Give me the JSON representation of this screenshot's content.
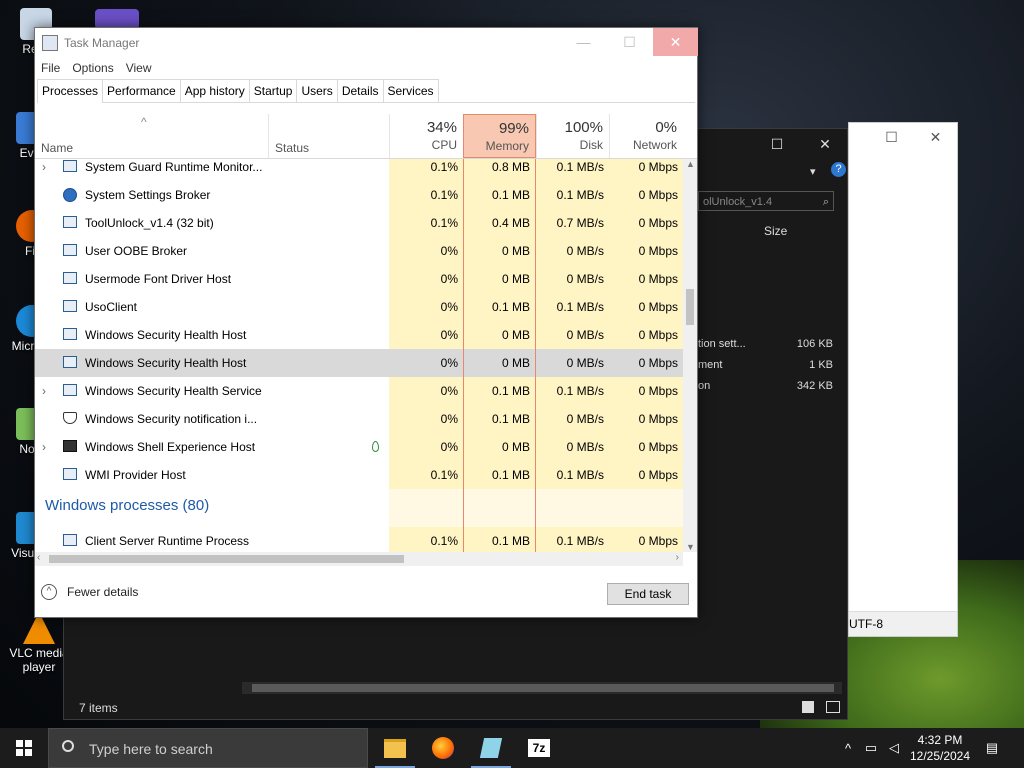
{
  "desktop": {
    "icons": [
      {
        "label": "Recy"
      },
      {
        "label": "Ever"
      },
      {
        "label": "Fir"
      },
      {
        "label": "Micr Ed"
      },
      {
        "label": "Note"
      },
      {
        "label": "Visua C"
      },
      {
        "label": "VLC media player"
      }
    ]
  },
  "explorer": {
    "search_text": "olUnlock_v1.4",
    "size_header": "Size",
    "rows": [
      {
        "name": "tion sett...",
        "size": "106 KB"
      },
      {
        "name": "ment",
        "size": "1 KB"
      },
      {
        "name": "on",
        "size": "342 KB"
      }
    ],
    "status": "7 items"
  },
  "notepad": {
    "encoding": "UTF-8"
  },
  "taskmanager": {
    "title": "Task Manager",
    "menu": [
      "File",
      "Options",
      "View"
    ],
    "tabs": [
      "Processes",
      "Performance",
      "App history",
      "Startup",
      "Users",
      "Details",
      "Services"
    ],
    "active_tab": "Processes",
    "columns": {
      "name": "Name",
      "status": "Status",
      "cpu": {
        "pct": "34%",
        "label": "CPU"
      },
      "memory": {
        "pct": "99%",
        "label": "Memory"
      },
      "disk": {
        "pct": "100%",
        "label": "Disk"
      },
      "network": {
        "pct": "0%",
        "label": "Network"
      }
    },
    "rows": [
      {
        "name": "System Guard Runtime Monitor...",
        "cpu": "0.1%",
        "mem": "0.8 MB",
        "disk": "0.1 MB/s",
        "net": "0 Mbps",
        "expandable": true,
        "icon": "window"
      },
      {
        "name": "System Settings Broker",
        "cpu": "0.1%",
        "mem": "0.1 MB",
        "disk": "0.1 MB/s",
        "net": "0 Mbps",
        "expandable": false,
        "icon": "gear"
      },
      {
        "name": "ToolUnlock_v1.4 (32 bit)",
        "cpu": "0.1%",
        "mem": "0.4 MB",
        "disk": "0.7 MB/s",
        "net": "0 Mbps",
        "expandable": false,
        "icon": "window"
      },
      {
        "name": "User OOBE Broker",
        "cpu": "0%",
        "mem": "0 MB",
        "disk": "0 MB/s",
        "net": "0 Mbps",
        "expandable": false,
        "icon": "window"
      },
      {
        "name": "Usermode Font Driver Host",
        "cpu": "0%",
        "mem": "0 MB",
        "disk": "0 MB/s",
        "net": "0 Mbps",
        "expandable": false,
        "icon": "window"
      },
      {
        "name": "UsoClient",
        "cpu": "0%",
        "mem": "0.1 MB",
        "disk": "0.1 MB/s",
        "net": "0 Mbps",
        "expandable": false,
        "icon": "window"
      },
      {
        "name": "Windows Security Health Host",
        "cpu": "0%",
        "mem": "0 MB",
        "disk": "0 MB/s",
        "net": "0 Mbps",
        "expandable": false,
        "icon": "window"
      },
      {
        "name": "Windows Security Health Host",
        "cpu": "0%",
        "mem": "0 MB",
        "disk": "0 MB/s",
        "net": "0 Mbps",
        "expandable": false,
        "icon": "window",
        "selected": true
      },
      {
        "name": "Windows Security Health Service",
        "cpu": "0%",
        "mem": "0.1 MB",
        "disk": "0.1 MB/s",
        "net": "0 Mbps",
        "expandable": true,
        "icon": "window"
      },
      {
        "name": "Windows Security notification i...",
        "cpu": "0%",
        "mem": "0.1 MB",
        "disk": "0 MB/s",
        "net": "0 Mbps",
        "expandable": false,
        "icon": "shield"
      },
      {
        "name": "Windows Shell Experience Host",
        "cpu": "0%",
        "mem": "0 MB",
        "disk": "0 MB/s",
        "net": "0 Mbps",
        "expandable": true,
        "icon": "dark",
        "leaf": true
      },
      {
        "name": "WMI Provider Host",
        "cpu": "0.1%",
        "mem": "0.1 MB",
        "disk": "0.1 MB/s",
        "net": "0 Mbps",
        "expandable": false,
        "icon": "window"
      }
    ],
    "group": {
      "title": "Windows processes (80)"
    },
    "after_group": [
      {
        "name": "Client Server Runtime Process",
        "cpu": "0.1%",
        "mem": "0.1 MB",
        "disk": "0.1 MB/s",
        "net": "0 Mbps",
        "expandable": false,
        "icon": "window"
      }
    ],
    "fewer_details": "Fewer details",
    "end_task": "End task"
  },
  "taskbar": {
    "search_placeholder": "Type here to search",
    "apps": [
      "file-explorer",
      "firefox",
      "notepad-app",
      "7zip"
    ],
    "app_7z_label": "7z",
    "time": "4:32 PM",
    "date": "12/25/2024"
  }
}
